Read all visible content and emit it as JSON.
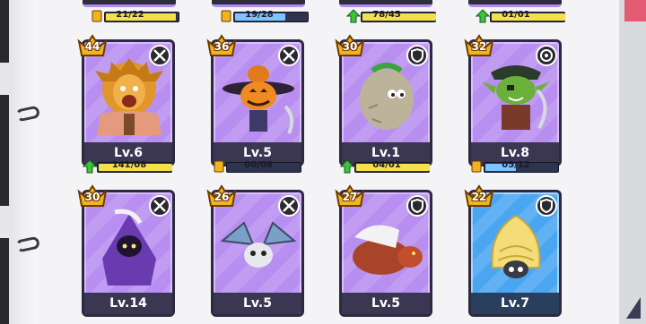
{
  "colors": {
    "card_purple": "#b88ff0",
    "card_blue": "#4ba6f2",
    "level_plate": "#3b3752",
    "progress_fill_yellow": "#f6e04a",
    "progress_fill_blue": "#7cc3ff",
    "upgrade_arrow": "#3cc43c",
    "crown_gold": "#f2b320"
  },
  "top_row": [
    {
      "progress": "21/22",
      "icon": "card-icon",
      "fill_fraction": 0.95
    },
    {
      "progress": "19/28",
      "icon": "card-icon",
      "fill_fraction": 0.68
    },
    {
      "progress": "78/45",
      "icon": "upgrade-arrow-icon",
      "fill_fraction": 1.0
    },
    {
      "progress": "01/01",
      "icon": "upgrade-arrow-icon",
      "fill_fraction": 1.0
    }
  ],
  "heroes": [
    {
      "name": "lion-warrior",
      "crown": "44",
      "class_icon": "crossed-swords-icon",
      "level": "Lv.6",
      "progress": "141/08",
      "progress_icon": "upgrade-arrow-icon",
      "fill_fraction": 1.0,
      "rarity": "epic"
    },
    {
      "name": "pumpkin-scarecrow",
      "crown": "36",
      "class_icon": "crossed-swords-icon",
      "level": "Lv.5",
      "progress": "00/06",
      "progress_icon": "card-icon",
      "fill_fraction": 0.0,
      "rarity": "epic"
    },
    {
      "name": "rock-golem",
      "crown": "30",
      "class_icon": "shield-icon",
      "level": "Lv.1",
      "progress": "04/01",
      "progress_icon": "upgrade-arrow-icon",
      "fill_fraction": 1.0,
      "rarity": "epic"
    },
    {
      "name": "goblin-pirate",
      "crown": "32",
      "class_icon": "target-icon",
      "level": "Lv.8",
      "progress": "05/12",
      "progress_icon": "card-icon",
      "fill_fraction": 0.42,
      "rarity": "epic"
    },
    {
      "name": "hooded-moon-mage",
      "crown": "30",
      "class_icon": "crossed-swords-icon",
      "level": "Lv.14",
      "rarity": "epic"
    },
    {
      "name": "skull-bat",
      "crown": "26",
      "class_icon": "crossed-swords-icon",
      "level": "Lv.5",
      "rarity": "epic"
    },
    {
      "name": "maned-beast",
      "crown": "27",
      "class_icon": "shield-icon",
      "level": "Lv.5",
      "rarity": "epic"
    },
    {
      "name": "hermit-snail",
      "crown": "22",
      "class_icon": "shield-icon",
      "level": "Lv.7",
      "rarity": "rare"
    }
  ]
}
